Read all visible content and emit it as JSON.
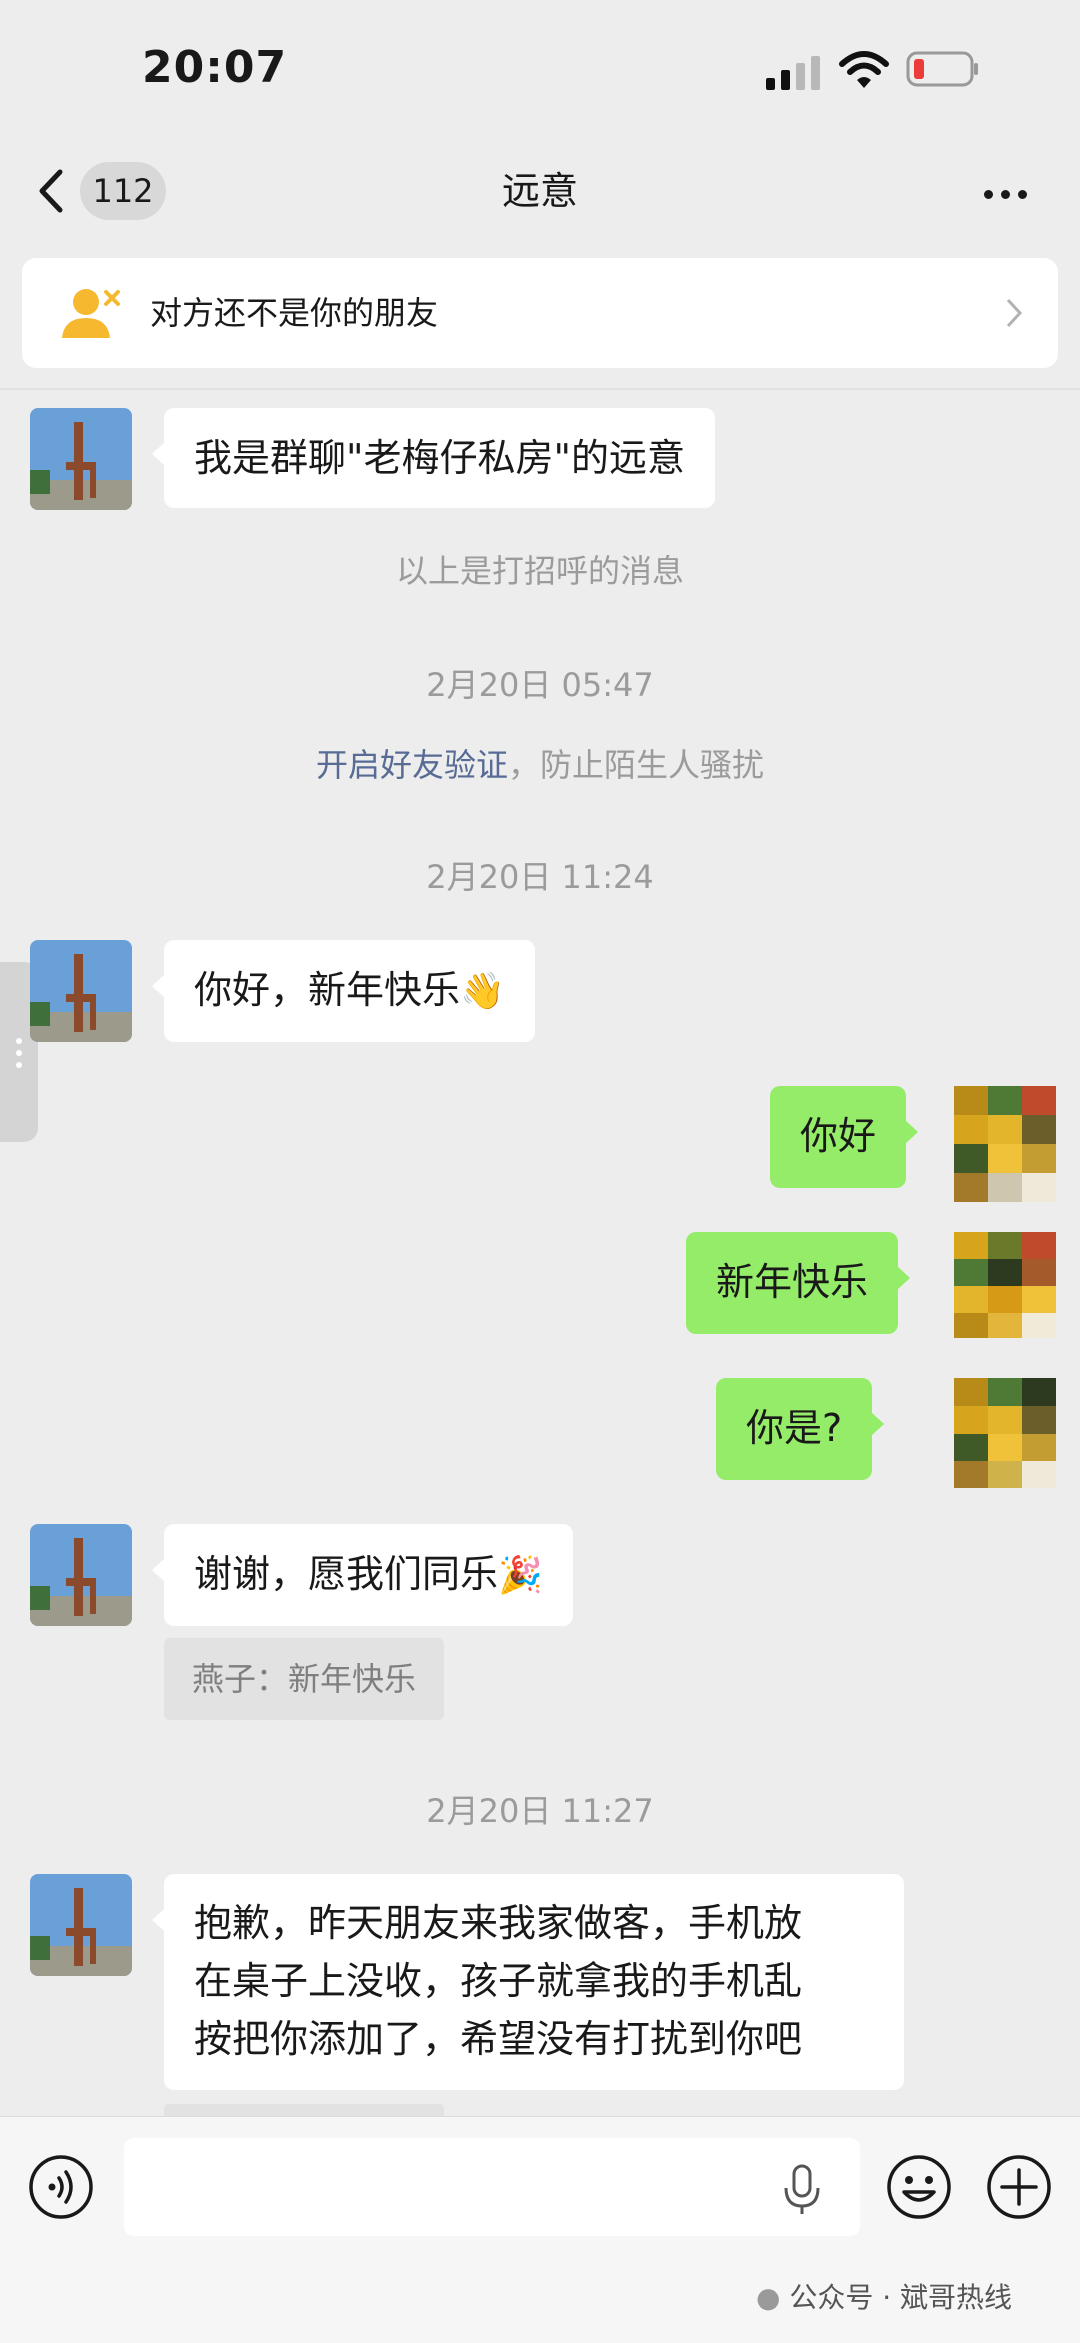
{
  "status_bar": {
    "time": "20:07"
  },
  "nav": {
    "back_count": "112",
    "title": "远意"
  },
  "notice": {
    "text": "对方还不是你的朋友"
  },
  "messages": {
    "m1": "我是群聊\"老梅仔私房\"的远意",
    "sys_greeting": "以上是打招呼的消息",
    "time1": "2月20日 05:47",
    "verify_link": "开启好友验证",
    "verify_rest": "，防止陌生人骚扰",
    "time2": "2月20日 11:24",
    "m2": "你好，新年快乐",
    "me1": "你好",
    "me2": "新年快乐",
    "me3": "你是?",
    "m3": "谢谢，愿我们同乐",
    "quote": "燕子：新年快乐",
    "time3": "2月20日 11:27",
    "m4_line1": "抱歉，昨天朋友来我家做客，手机放",
    "m4_line2": "在桌子上没收，孩子就拿我的手机乱",
    "m4_line3": "按把你添加了，希望没有打扰到你吧"
  },
  "input_bar": {
    "voice_icon": "voice-icon",
    "mic_icon": "mic-icon",
    "emoji_icon": "emoji-icon",
    "plus_icon": "plus-icon"
  },
  "watermark": "公众号 · 斌哥热线",
  "colors": {
    "background": "#ededed",
    "my_bubble": "#95ec69",
    "other_bubble": "#ffffff",
    "link": "#576b95"
  }
}
